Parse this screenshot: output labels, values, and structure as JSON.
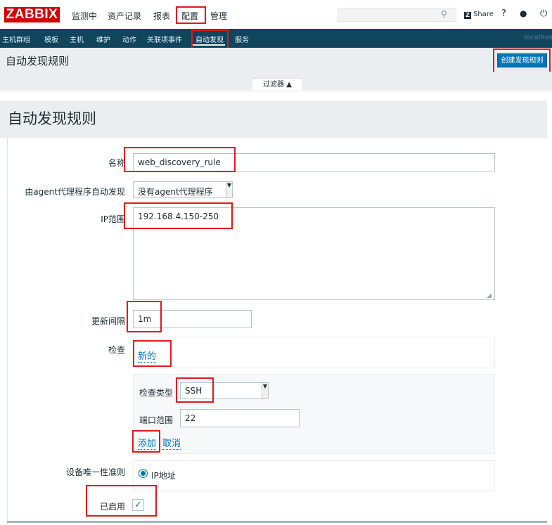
{
  "header": {
    "logo": "ZABBIX",
    "menu": [
      "监测中",
      "资产记录",
      "报表",
      "配置",
      "管理"
    ],
    "share_label": "Share",
    "share_box": "Z",
    "help": "?",
    "user_icon": " •",
    "power_icon": "⏻"
  },
  "subnav": {
    "items": [
      "主机群组",
      "模板",
      "主机",
      "维护",
      "动作",
      "关联项事件",
      "自动发现",
      "服务"
    ],
    "host": "localhos"
  },
  "page": {
    "title": "自动发现规则",
    "create_button": "创建发现规则",
    "filter_tab": "过滤器 ▲"
  },
  "form": {
    "title": "自动发现规则",
    "name_label": "名称",
    "name_value": "web_discovery_rule",
    "proxy_label": "由agent代理程序自动发现",
    "proxy_value": "没有agent代理程序",
    "ip_label": "IP范围",
    "ip_value": "192.168.4.150-250",
    "interval_label": "更新间隔",
    "interval_value": "1m",
    "checks_label": "检查",
    "checks_new": "新的",
    "check_type_label": "检查类型",
    "check_type_value": "SSH",
    "port_label": "端口范围",
    "port_value": "22",
    "add_link": "添加",
    "cancel_link": "取消",
    "uniq_label": "设备唯一性准则",
    "uniq_option": "IP地址",
    "enabled_label": "已启用",
    "enabled_mark": "✓"
  },
  "colors": {
    "logo": "#d40000",
    "subnav": "#0f455d",
    "accent": "#0275b8",
    "highlight": "#e0191f"
  }
}
